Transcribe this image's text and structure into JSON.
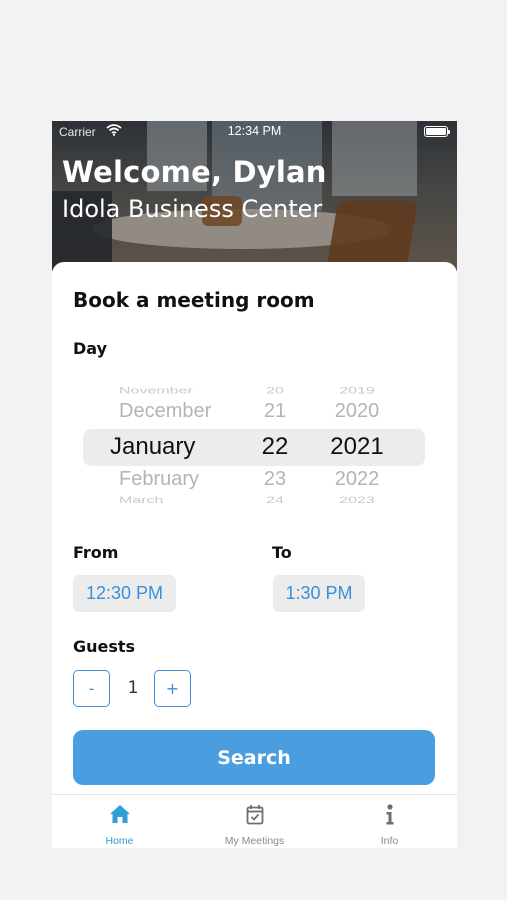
{
  "status_bar": {
    "carrier": "Carrier",
    "time": "12:34 PM"
  },
  "header": {
    "welcome": "Welcome, Dylan",
    "center": "Idola Business Center"
  },
  "booking": {
    "title": "Book a meeting room",
    "day_label": "Day",
    "picker": {
      "months": [
        "November",
        "December",
        "January",
        "February",
        "March"
      ],
      "days": [
        "20",
        "21",
        "22",
        "23",
        "24"
      ],
      "years": [
        "2019",
        "2020",
        "2021",
        "2022",
        "2023"
      ],
      "selected": {
        "month": "January",
        "day": "22",
        "year": "2021"
      }
    },
    "from_label": "From",
    "from_value": "12:30 PM",
    "to_label": "To",
    "to_value": "1:30 PM",
    "guests_label": "Guests",
    "guests_minus": "-",
    "guests_count": "1",
    "guests_plus": "+",
    "search_label": "Search"
  },
  "tabbar": {
    "active_color": "#2f9fd6",
    "items": [
      {
        "label": "Home",
        "icon": "home-icon"
      },
      {
        "label": "My Meetings",
        "icon": "calendar-check-icon"
      },
      {
        "label": "Info",
        "icon": "info-icon"
      }
    ]
  }
}
